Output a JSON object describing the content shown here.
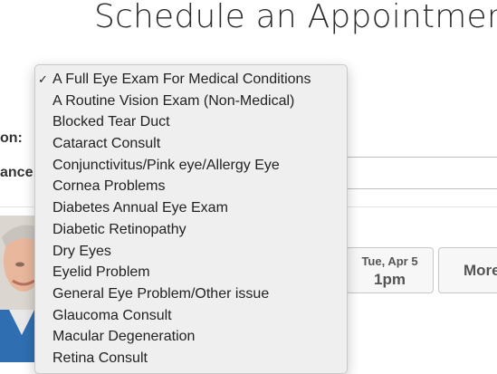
{
  "page": {
    "title": "Schedule an Appointment"
  },
  "form": {
    "reason_label": "on:",
    "insurance_label": "ance:"
  },
  "slots": [
    {
      "date": "Tue, Apr 5",
      "time": "1pm"
    }
  ],
  "more_label": "More",
  "reason_dropdown": {
    "selected_index": 0,
    "options": [
      "A Full Eye Exam For Medical Conditions",
      "A Routine Vision Exam (Non-Medical)",
      "Blocked Tear Duct",
      "Cataract Consult",
      "Conjunctivitus/Pink eye/Allergy Eye",
      "Cornea Problems",
      "Diabetes Annual Eye Exam",
      "Diabetic Retinopathy",
      "Dry Eyes",
      "Eyelid Problem",
      "General Eye Problem/Other issue",
      "Glaucoma Consult",
      "Macular Degeneration",
      "Retina Consult"
    ]
  },
  "icons": {
    "check": "checkmark-icon"
  },
  "colors": {
    "dropdown_bg": "#efefef",
    "button_bg": "#f7f7f7"
  }
}
